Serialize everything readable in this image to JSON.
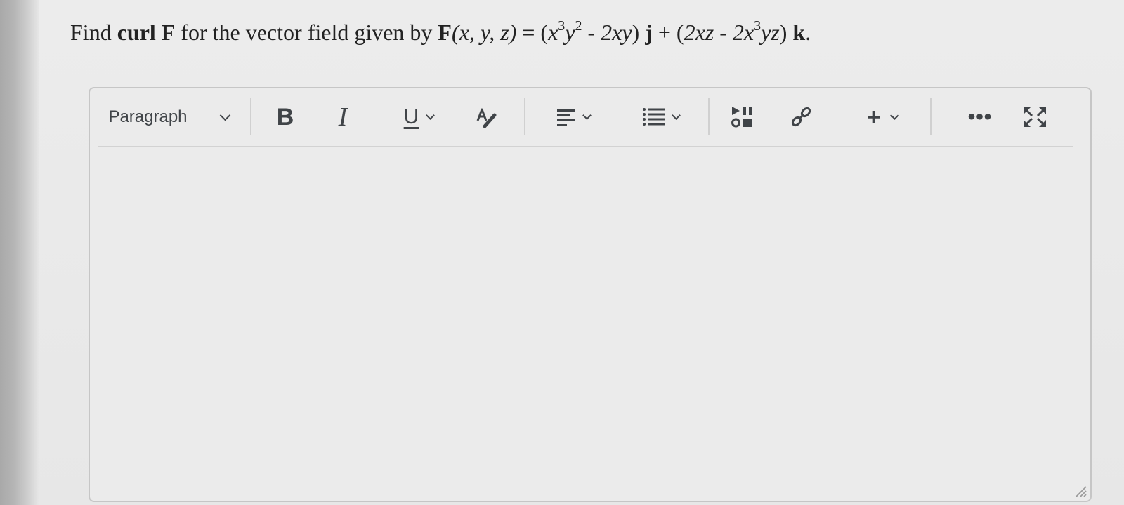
{
  "question": {
    "intro": "Find ",
    "curl_bold": "curl F",
    "middle": " for the vector field given by ",
    "F_bold": "F",
    "args": "(x, y, z)",
    "equals": " = (",
    "j_term_a": "x",
    "exp_3a": "3",
    "j_term_b": "y",
    "exp_2": "2",
    "j_term_c": " - 2xy",
    "close_j": ") ",
    "j_bold": "j",
    "plus_open": " + (",
    "k_term_a": "2xz - 2x",
    "exp_3b": "3",
    "k_term_b": "yz",
    "close_k": ") ",
    "k_bold": "k",
    "period": "."
  },
  "toolbar": {
    "paragraph_label": "Paragraph",
    "bold_label": "B",
    "italic_label": "I",
    "underline_label": "U",
    "insert_label": "+",
    "more_label": "•••",
    "icons": [
      "chevron-down-icon",
      "text-color-icon",
      "align-icon",
      "list-icon",
      "media-icon",
      "link-icon",
      "more-icon",
      "fullscreen-icon"
    ]
  },
  "editor": {
    "content": ""
  }
}
